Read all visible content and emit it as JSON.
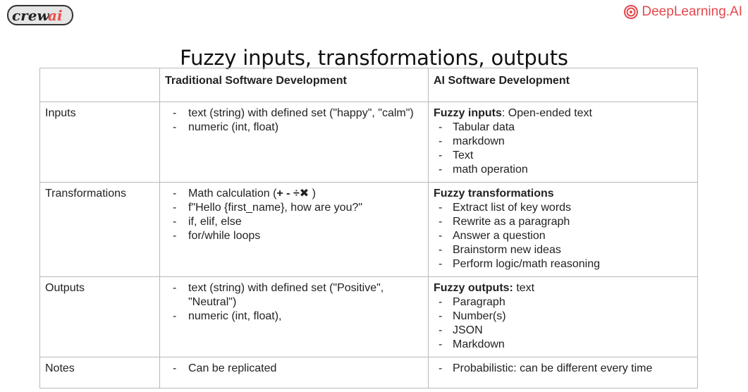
{
  "logos": {
    "crewai": "crewai",
    "deeplearning": "DeepLearning.AI"
  },
  "title": "Fuzzy inputs, transformations, outputs",
  "table": {
    "headers": [
      "",
      "Traditional Software Development",
      "AI Software Development"
    ],
    "rows": [
      {
        "label": "Inputs",
        "traditional": [
          "text (string) with defined set (\"happy\", \"calm\")",
          "numeric (int, float)"
        ],
        "ai_bold": "Fuzzy inputs",
        "ai_rest": ": Open-ended text",
        "ai_items": [
          "Tabular data",
          "markdown",
          "Text",
          "math operation"
        ]
      },
      {
        "label": "Transformations",
        "traditional_first_prefix": "Math calculation (",
        "traditional_first_symbols": "+ - ÷✖",
        "traditional_first_suffix": " )",
        "traditional": [
          "f\"Hello {first_name}, how are you?\"",
          "if, elif, else",
          "for/while loops"
        ],
        "ai_bold": "Fuzzy transformations",
        "ai_rest": "",
        "ai_items": [
          "Extract list of key words",
          "Rewrite as a paragraph",
          "Answer a question",
          "Brainstorm new ideas",
          "Perform logic/math reasoning"
        ]
      },
      {
        "label": "Outputs",
        "traditional": [
          "text (string) with defined set (\"Positive\", \"Neutral\")",
          "numeric (int, float),"
        ],
        "ai_bold": "Fuzzy outputs:",
        "ai_rest": " text",
        "ai_items": [
          "Paragraph",
          "Number(s)",
          "JSON",
          "Markdown"
        ]
      },
      {
        "label": "Notes",
        "traditional": [
          "Can be replicated"
        ],
        "ai_items": [
          "Probabilistic: can be different every time"
        ]
      }
    ]
  },
  "colors": {
    "deeplearning_brand": "#e5484d",
    "crewai_brand": "#e8504a",
    "border": "#b9b9b9"
  }
}
